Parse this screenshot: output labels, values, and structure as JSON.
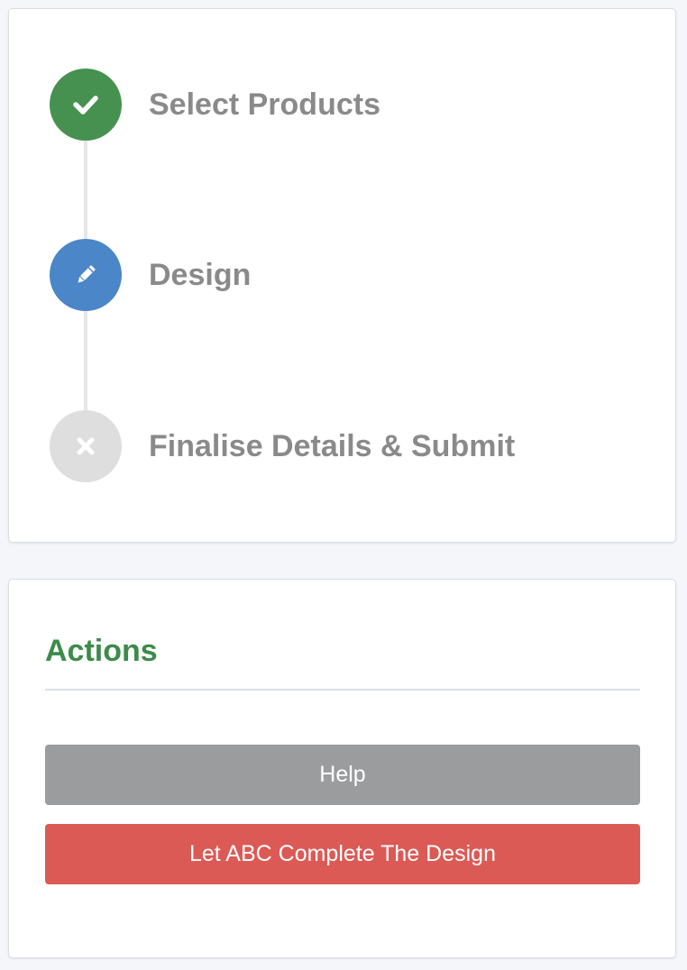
{
  "steps": [
    {
      "label": "Select Products",
      "status": "complete",
      "color": "#46914f",
      "icon": "check-icon"
    },
    {
      "label": "Design",
      "status": "current",
      "color": "#4a86c8",
      "icon": "pencil-icon"
    },
    {
      "label": "Finalise Details & Submit",
      "status": "pending",
      "color": "#dedede",
      "icon": "close-icon"
    }
  ],
  "actions": {
    "title": "Actions",
    "title_color": "#3d8b4b",
    "help_label": "Help",
    "help_color": "#9a9c9e",
    "complete_label": "Let ABC Complete The Design",
    "complete_color": "#dc5a55"
  }
}
